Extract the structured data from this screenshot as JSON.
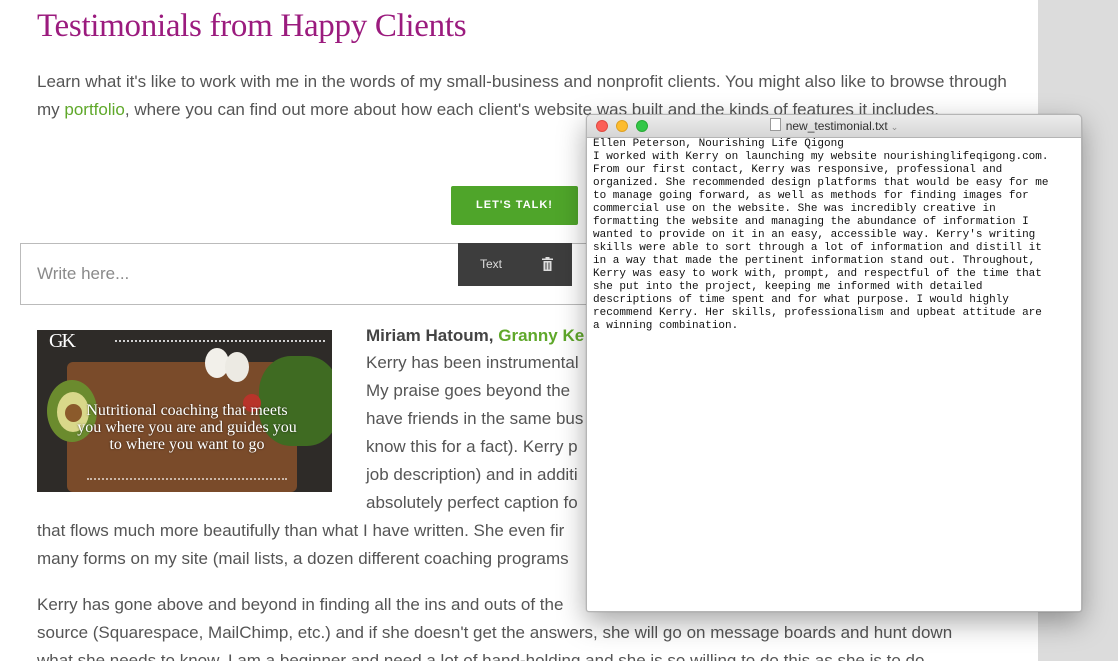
{
  "page": {
    "title": "Testimonials from Happy Clients",
    "intro_before": "Learn what it's like to work with me in the words of my small-business and nonprofit clients. You might also like to browse through my ",
    "intro_link": "portfolio",
    "intro_after": ", where you can find out more about how each client's website was built and the kinds of features it includes.",
    "cta_label": "LET'S TALK!"
  },
  "editor": {
    "placeholder": "Write here...",
    "toolbar_label": "Text",
    "trash_icon": "trash-icon"
  },
  "hero_image": {
    "logo": "GK",
    "caption": "Nutritional coaching that meets you where you are and guides you to where you want to go"
  },
  "testimonial": {
    "name": "Miriam Hatoum, ",
    "business": "Granny Ke",
    "lines": [
      "Kerry has been instrumental",
      "My praise goes beyond the",
      "have friends in the same bus",
      "know this for a fact). Kerry p",
      "job description) and in additi",
      "absolutely perfect caption fo"
    ],
    "full_lines": [
      "that flows much more beautifully than what I have written. She even fir",
      "many forms on my site (mail lists, a dozen different coaching programs",
      "Kerry has gone above and beyond in finding all the ins and outs of the",
      "source (Squarespace, MailChimp, etc.) and if she doesn't get the answers, she will go on message boards and hunt down",
      "what she needs to know. I am a beginner and need a lot of hand-holding and she is so willing to do this as she is to do"
    ]
  },
  "textedit": {
    "filename": "new_testimonial.txt",
    "lines": [
      "Ellen Peterson, Nourishing Life Qigong",
      "I worked with Kerry on launching my website nourishinglifeqigong.com.",
      "From our first contact, Kerry was responsive, professional and",
      "organized. She recommended design platforms that would be easy for me",
      "to manage going forward, as well as methods for finding images for",
      "commercial use on the website. She was incredibly creative in",
      "formatting the website and managing the abundance of information I",
      "wanted to provide on it in an easy, accessible way. Kerry's writing",
      "skills were able to sort through a lot of information and distill it",
      "in a way that made the pertinent information stand out. Throughout,",
      "Kerry was easy to work with, prompt, and respectful of the time that",
      "she put into the project, keeping me informed with detailed",
      "descriptions of time spent and for what purpose. I would highly",
      "recommend Kerry. Her skills, professionalism and upbeat attitude are",
      "a winning combination."
    ]
  },
  "colors": {
    "title": "#9b1b7e",
    "link": "#5fa82a",
    "cta": "#4fa52a",
    "toolbar": "#3d3d3d",
    "gutter": "#dcdcdc"
  }
}
